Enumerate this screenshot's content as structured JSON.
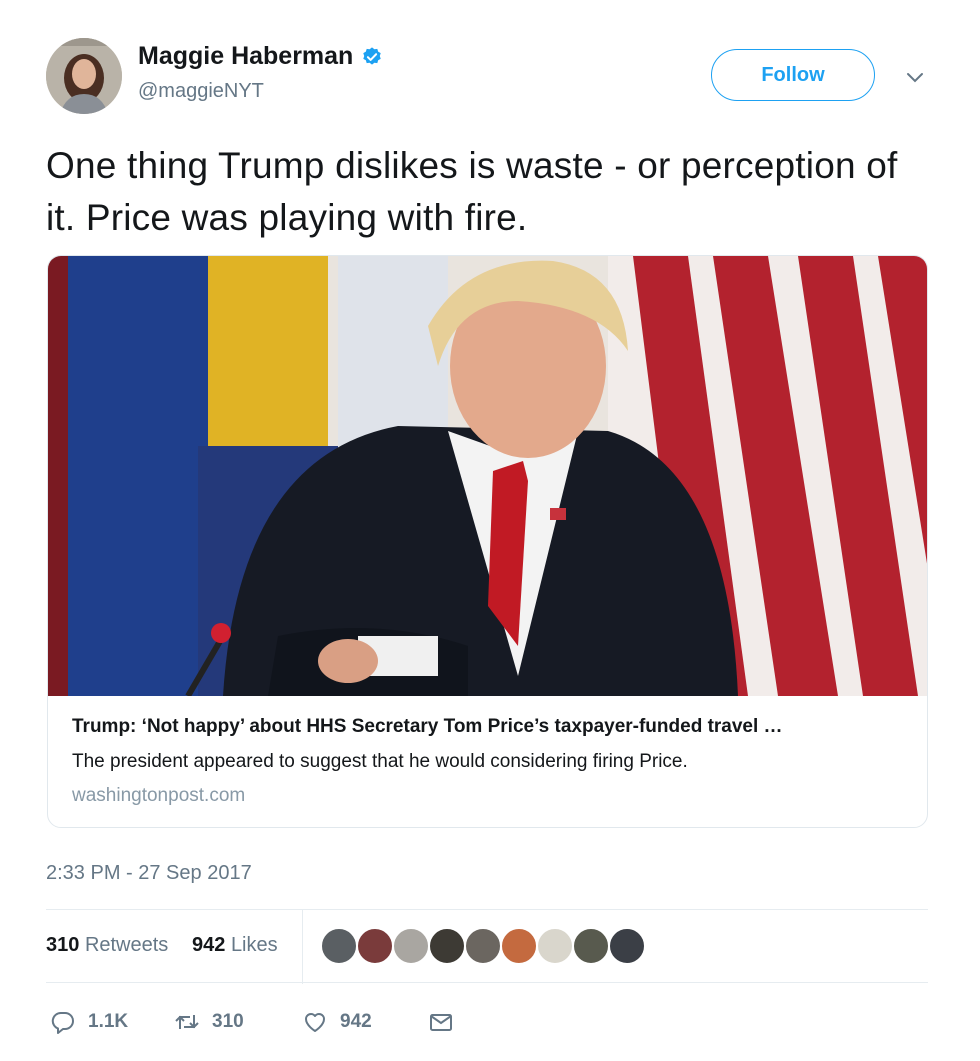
{
  "author": {
    "name": "Maggie Haberman",
    "handle": "@maggieNYT",
    "verified": true
  },
  "follow_label": "Follow",
  "tweet_text": "One thing Trump dislikes is waste - or perception of it. Price was playing with fire.",
  "card": {
    "title": "Trump: ‘Not happy’ about HHS Secretary Tom Price’s taxpayer-funded travel …",
    "description": "The president appeared to suggest that he would considering firing Price.",
    "domain": "washingtonpost.com"
  },
  "timestamp": "2:33 PM - 27 Sep 2017",
  "stats": {
    "retweets_count": "310",
    "retweets_label": "Retweets",
    "likes_count": "942",
    "likes_label": "Likes"
  },
  "actions": {
    "reply_count": "1.1K",
    "retweet_count": "310",
    "like_count": "942"
  },
  "colors": {
    "accent": "#1da1f2",
    "secondary_text": "#657786",
    "border": "#e1e8ed"
  },
  "icons": [
    "verified-badge-icon",
    "chevron-down-icon",
    "reply-icon",
    "retweet-icon",
    "heart-icon",
    "direct-message-icon"
  ]
}
